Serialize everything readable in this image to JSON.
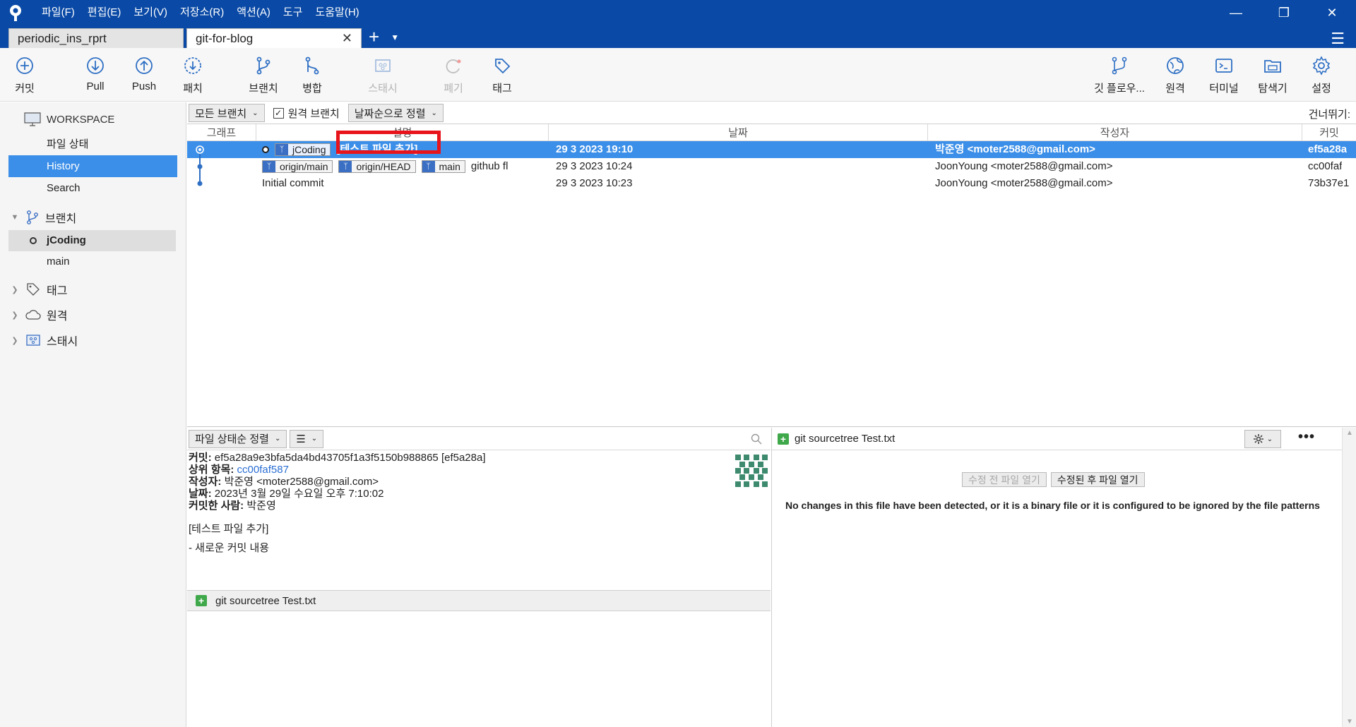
{
  "menu": [
    "파일(F)",
    "편집(E)",
    "보기(V)",
    "저장소(R)",
    "액션(A)",
    "도구",
    "도움말(H)"
  ],
  "tabs": [
    {
      "label": "periodic_ins_rprt"
    },
    {
      "label": "git-for-blog"
    }
  ],
  "toolbar": {
    "commit": "커밋",
    "pull": "Pull",
    "push": "Push",
    "patch": "패치",
    "branch": "브랜치",
    "merge": "병합",
    "stash": "스태시",
    "discard": "폐기",
    "tag": "태그",
    "gitflow": "깃 플로우...",
    "remote": "원격",
    "terminal": "터미널",
    "explorer": "탐색기",
    "settings": "설정"
  },
  "sidebar": {
    "workspace": "WORKSPACE",
    "items": [
      "파일 상태",
      "History",
      "Search"
    ],
    "branches_label": "브랜치",
    "branches": [
      "jCoding",
      "main"
    ],
    "tags_label": "태그",
    "remotes_label": "원격",
    "stash_label": "스태시"
  },
  "filter": {
    "branch_dd": "모든 브랜치",
    "remote_check": "원격 브랜치",
    "sort_dd": "날짜순으로 정렬",
    "jump": "건너뛰기:"
  },
  "columns": {
    "graph": "그래프",
    "desc": "설명",
    "date": "날짜",
    "author": "작성자",
    "commit": "커밋"
  },
  "commits": [
    {
      "refs": [
        "jCoding"
      ],
      "message": "[테스트 파일 추가]",
      "date": "29 3 2023 19:10",
      "author": "박준영 <moter2588@gmail.com>",
      "hash": "ef5a28a"
    },
    {
      "refs": [
        "origin/main",
        "origin/HEAD",
        "main"
      ],
      "message": "github fl",
      "date": "29 3 2023 10:24",
      "author": "JoonYoung <moter2588@gmail.com>",
      "hash": "cc00faf"
    },
    {
      "refs": [],
      "message": "Initial commit",
      "date": "29 3 2023 10:23",
      "author": "JoonYoung <moter2588@gmail.com>",
      "hash": "73b37e1"
    }
  ],
  "detail": {
    "sort_dd": "파일 상태순 정렬",
    "commit_label": "커밋:",
    "commit_value": "ef5a28a9e3bfa5da4bd43705f1a3f5150b988865 [ef5a28a]",
    "parent_label": "상위 항목:",
    "parent_value": "cc00faf587",
    "author_label": "작성자:",
    "author_value": "박준영 <moter2588@gmail.com>",
    "date_label": "날짜:",
    "date_value": "2023년 3월 29일 수요일 오후 7:10:02",
    "committer_label": "커밋한 사람:",
    "committer_value": "박준영",
    "msg_line1": "[테스트 파일 추가]",
    "msg_line2": "- 새로운 커밋 내용",
    "file": "git sourcetree Test.txt"
  },
  "diff": {
    "file": "git sourcetree Test.txt",
    "btn_before": "수정 전 파일 열기",
    "btn_after": "수정된 후 파일 열기",
    "message": "No changes in this file have been detected, or it is a binary file or it is configured to be ignored by the file patterns"
  },
  "colors": {
    "titlebar": "#0a4aa6",
    "selection": "#3c8fe8",
    "highlight": "#e8141c"
  }
}
